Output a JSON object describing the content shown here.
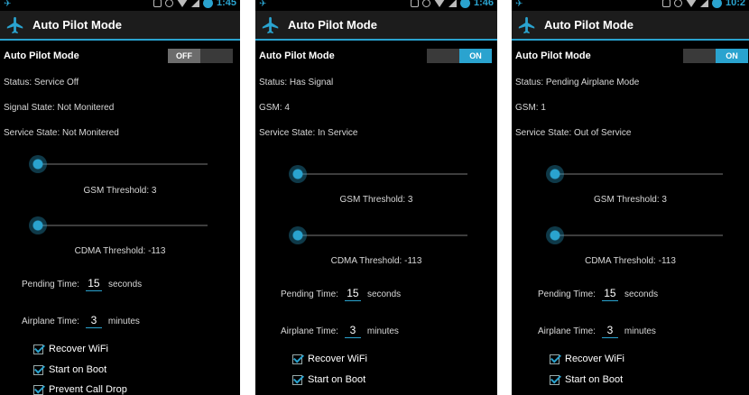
{
  "colors": {
    "accent": "#2aa3cf",
    "background": "#000000",
    "actionbar": "#1c1c1c"
  },
  "screens": [
    {
      "status_time": "1:45",
      "app_title": "Auto Pilot Mode",
      "toggle_label": "Auto Pilot Mode",
      "toggle_state": "OFF",
      "lines": [
        "Status: Service Off",
        "Signal State: Not Monitered",
        "Service State: Not Monitered"
      ],
      "gsm_threshold": "GSM Threshold: 3",
      "cdma_threshold": "CDMA Threshold: -113",
      "gsm_slider_fraction": 0.0,
      "cdma_slider_fraction": 0.0,
      "pending_label": "Pending Time:",
      "pending_value": "15",
      "pending_unit": "seconds",
      "airplane_label": "Airplane Time:",
      "airplane_value": "3",
      "airplane_unit": "minutes",
      "checks": [
        "Recover WiFi",
        "Start on Boot",
        "Prevent Call Drop"
      ]
    },
    {
      "status_time": "1:46",
      "app_title": "Auto Pilot Mode",
      "toggle_label": "Auto Pilot Mode",
      "toggle_state": "ON",
      "lines": [
        "Status: Has Signal",
        "GSM: 4",
        "Service State: In Service"
      ],
      "gsm_threshold": "GSM Threshold: 3",
      "cdma_threshold": "CDMA Threshold: -113",
      "gsm_slider_fraction": 0.0,
      "cdma_slider_fraction": 0.0,
      "pending_label": "Pending Time:",
      "pending_value": "15",
      "pending_unit": "seconds",
      "airplane_label": "Airplane Time:",
      "airplane_value": "3",
      "airplane_unit": "minutes",
      "checks": [
        "Recover WiFi",
        "Start on Boot"
      ]
    },
    {
      "status_time": "10:2",
      "app_title": "Auto Pilot Mode",
      "toggle_label": "Auto Pilot Mode",
      "toggle_state": "ON",
      "lines": [
        "Status: Pending Airplane Mode",
        "GSM: 1",
        "Service State: Out of Service"
      ],
      "gsm_threshold": "GSM Threshold: 3",
      "cdma_threshold": "CDMA Threshold: -113",
      "gsm_slider_fraction": 0.0,
      "cdma_slider_fraction": 0.0,
      "pending_label": "Pending Time:",
      "pending_value": "15",
      "pending_unit": "seconds",
      "airplane_label": "Airplane Time:",
      "airplane_value": "3",
      "airplane_unit": "minutes",
      "checks": [
        "Recover WiFi",
        "Start on Boot"
      ]
    }
  ]
}
